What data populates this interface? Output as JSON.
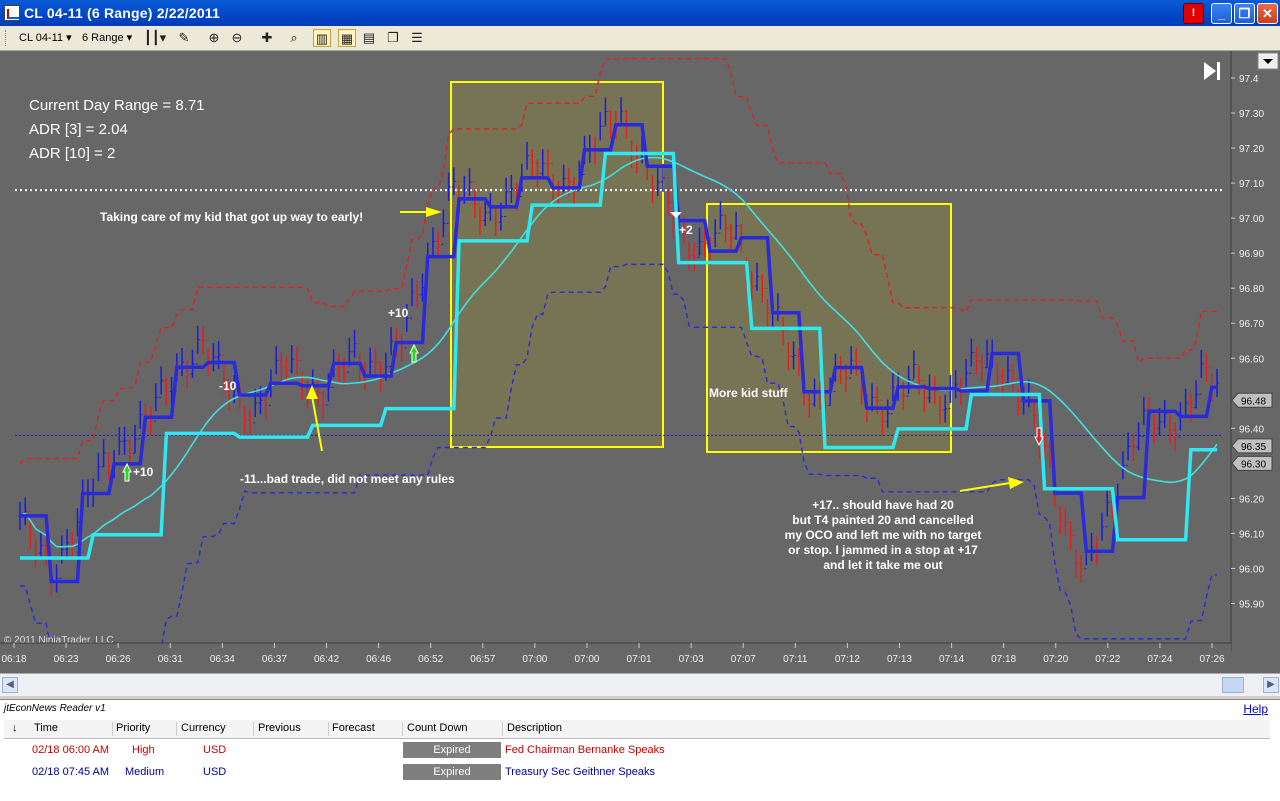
{
  "window": {
    "title": "CL 04-11 (6 Range)  2/22/2011"
  },
  "toolbar": {
    "instrument": "CL 04-11",
    "period": "6 Range"
  },
  "chart_info": {
    "line1": "Current Day Range = 8.71",
    "line2": "ADR [3] = 2.04",
    "line3": "ADR [10] = 2"
  },
  "annotations": {
    "kid_early": "Taking care of my kid that got up way to early!",
    "bad_trade": "-11...bad trade, did not meet any rules",
    "kid_stuff": "More kid stuff",
    "note1": "+17.. should have had 20",
    "note2": "but T4 painted 20 and cancelled",
    "note3": "my OCO and left me with no target",
    "note4": "or stop. I jammed in a stop at +17",
    "note5": "and let it take me out",
    "t_plus10a": "+10",
    "t_minus10": "-10",
    "t_plus10b": "+10",
    "t_plus2": "+2"
  },
  "copyright": "© 2011 NinjaTrader, LLC",
  "chart_data": {
    "type": "line",
    "title": "CL 04-11 (6 Range)  2/22/2011",
    "y_ticks": [
      "97.4",
      "97.30",
      "97.20",
      "97.10",
      "97.00",
      "96.90",
      "96.80",
      "96.70",
      "96.60",
      "96.40",
      "96.10",
      "96.00",
      "95.90"
    ],
    "y_all_ticks": [
      97.4,
      97.3,
      97.2,
      97.1,
      97.0,
      96.9,
      96.8,
      96.7,
      96.6,
      96.5,
      96.4,
      96.3,
      96.2,
      96.1,
      96.0,
      95.9
    ],
    "y_labels_shown": [
      "97.4",
      "97.30",
      "97.20",
      "97.10",
      "97.00",
      "96.90",
      "96.80",
      "96.70",
      "96.60",
      "96.40",
      "96.20",
      "96.10",
      "96.00",
      "95.90"
    ],
    "price_boxes": [
      "96.48",
      "96.35",
      "96.30"
    ],
    "x_ticks": [
      "06:18",
      "06:23",
      "06:26",
      "06:31",
      "06:34",
      "06:37",
      "06:42",
      "06:46",
      "06:52",
      "06:57",
      "07:00",
      "07:00",
      "07:01",
      "07:03",
      "07:07",
      "07:11",
      "07:12",
      "07:13",
      "07:14",
      "07:18",
      "07:20",
      "07:22",
      "07:24",
      "07:26"
    ],
    "reference_lines": {
      "dotted_white": 97.08,
      "dotted_blue": 96.38
    },
    "ylim": [
      95.85,
      97.42
    ],
    "price_path": [
      96.15,
      96.05,
      95.98,
      96.1,
      96.2,
      96.28,
      96.35,
      96.4,
      96.45,
      96.52,
      96.6,
      96.65,
      96.55,
      96.48,
      96.45,
      96.52,
      96.58,
      96.55,
      96.5,
      96.55,
      96.6,
      96.58,
      96.6,
      96.65,
      96.8,
      96.95,
      97.1,
      97.05,
      97.0,
      97.05,
      97.1,
      97.15,
      97.12,
      97.1,
      97.15,
      97.25,
      97.32,
      97.2,
      97.1,
      97.05,
      96.95,
      96.9,
      96.95,
      96.98,
      96.85,
      96.75,
      96.65,
      96.55,
      96.48,
      96.52,
      96.58,
      96.5,
      96.45,
      96.5,
      96.55,
      96.5,
      96.48,
      96.55,
      96.62,
      96.58,
      96.5,
      96.42,
      96.3,
      96.1,
      95.98,
      96.1,
      96.25,
      96.38,
      96.42,
      96.4,
      96.45,
      96.55,
      96.52
    ]
  },
  "news": {
    "title": "jtEconNews Reader v1",
    "help": "Help",
    "sort_icon": "sort-down-arrow",
    "columns": [
      "Time",
      "Priority",
      "Currency",
      "Previous",
      "Forecast",
      "Count Down",
      "Description"
    ],
    "rows": [
      {
        "time": "02/18 06:00 AM",
        "priority": "High",
        "currency": "USD",
        "previous": "",
        "forecast": "",
        "countdown": "Expired",
        "description": "Fed Chairman Bernanke Speaks",
        "color": "#cc0000"
      },
      {
        "time": "02/18 07:45 AM",
        "priority": "Medium",
        "currency": "USD",
        "previous": "",
        "forecast": "",
        "countdown": "Expired",
        "description": "Treasury Sec Geithner Speaks",
        "color": "#000099"
      }
    ]
  }
}
